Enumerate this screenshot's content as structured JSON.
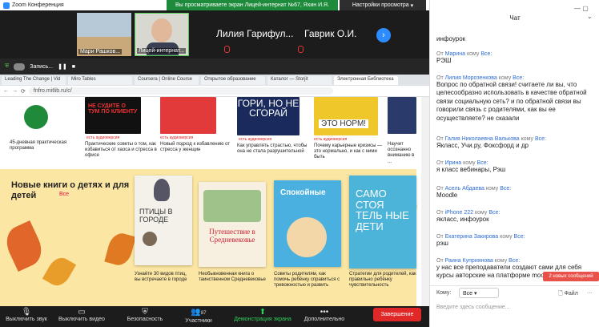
{
  "window": {
    "title": "Zoom Конференция",
    "share_banner": "Вы просматриваете экран Лицей-интернат №67, Яхин И.Я.",
    "view_options": "Настройки просмотра"
  },
  "participants": [
    {
      "name": "Мари Рашков..."
    },
    {
      "name": "Лицей-интернат..."
    },
    {
      "name": "Лилия Гарифул..."
    },
    {
      "name": "Гаврик О.И."
    }
  ],
  "share_ctrl": {
    "label": "Запись..."
  },
  "browser": {
    "tabs": [
      "Leading The Change | Vid",
      "Miro Tables",
      "Coursera | Online Course",
      "Открытое образование",
      "Каталог — Storjit",
      "Электронная Библиотека"
    ],
    "url": "fnfro.mitlib.ru/c/"
  },
  "page": {
    "top_captions": [
      "45-дневная практическая программа",
      "Практические советы о том, как избавиться от хаоса и стресса в офисе",
      "Новый подход к избавлению от стресса у женщин",
      "Как управлять страстью, чтобы она не стала разрушительной",
      "Почему карьерные кризисы — это нормально, и как с ними быть",
      "Научит осознанно вниманию в ..."
    ],
    "badge": "есть аудиоверсия",
    "section_title": "Новые книги о детях и для детей",
    "section_link": "Все",
    "book_titles": [
      "ПТИЦЫ В ГОРОДЕ",
      "Путешествие в Средневековье",
      "Спокойные",
      "САМО СТОЯ ТЕЛЬ НЫЕ ДЕТИ"
    ],
    "bottom_captions": [
      "Узнаёте 30 видов птиц, вы встречаете в городе",
      "Необыкновенная книга о таинственном Средневековье",
      "Советы родителям, как помочь ребёнку справиться с тревожностью и развить",
      "Стратегии для родителей, как правильно ребёнку чувствительность"
    ],
    "cover_texts": {
      "c1": "НЕ СУДИТЕ О ТУМ ПО КЛИЕНТУ",
      "c3": "ГОРИ, НО НЕ СГОРАЙ",
      "c4": "ЭТО НОРМ!"
    }
  },
  "toolbar": {
    "mute": "Выключить звук",
    "video": "Выключить видео",
    "security": "Безопасность",
    "participants": "Участники",
    "participants_count": "87",
    "share": "Демонстрация экрана",
    "more": "Дополнительно",
    "end": "Завершение"
  },
  "chat": {
    "title": "Чат",
    "messages": [
      {
        "text": "инфоурок"
      },
      {
        "from": "Марина",
        "text": "РЭШ"
      },
      {
        "from": "Лилия Морозенкова",
        "text": "Вопрос по обратной связи! считаете ли вы, что целесообразно использовать в качестве обратной связи социальную сеть? и по обратной связи вы говорили связь с родителями, как вы ее осуществляете? не сказали"
      },
      {
        "from": "Галия Николаевна Валькова",
        "text": "Якласс, Учи.ру, Фоксфорд и др"
      },
      {
        "from": "Ирина",
        "text": "я класс вебинары, Рэш"
      },
      {
        "from": "Асель Абдаева",
        "text": "Moodle"
      },
      {
        "from": "iPhone 222",
        "text": "якласс, инфоурок"
      },
      {
        "from": "Екатерина Закирова",
        "text": "рэш"
      },
      {
        "from": "Раина Куприянова",
        "text": "у нас все преподаватели создают сами для себя курсы авторские на платформе moodle"
      }
    ],
    "to_word": "кому",
    "all_word": "Все:",
    "from_word": "От",
    "new_messages": "2 новых сообщений",
    "to_label": "Кому:",
    "to_value": "Все",
    "file_label": "Файл",
    "input_placeholder": "Введите здесь сообщение..."
  }
}
